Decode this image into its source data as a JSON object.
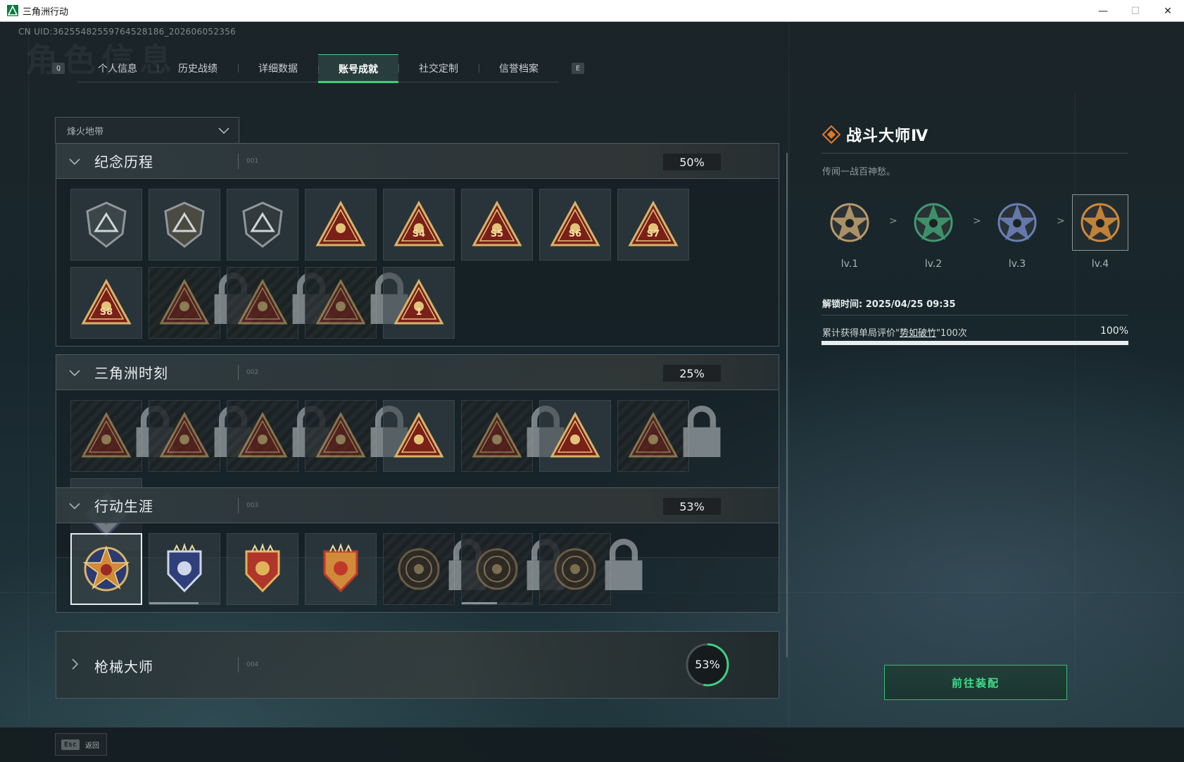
{
  "window": {
    "title": "三角洲行动",
    "minimize": "—",
    "maximize": "☐",
    "close": "✕"
  },
  "uid": "CN UID:3625548255976452818​6_202606052356",
  "watermark": "角色信息",
  "tabs": {
    "left_key": "Q",
    "right_key": "E",
    "items": [
      {
        "label": "个人信息",
        "active": false
      },
      {
        "label": "历史战绩",
        "active": false
      },
      {
        "label": "详细数据",
        "active": false
      },
      {
        "label": "账号成就",
        "active": true
      },
      {
        "label": "社交定制",
        "active": false
      },
      {
        "label": "信誉档案",
        "active": false
      }
    ]
  },
  "mode_select": {
    "value": "烽火地带"
  },
  "sections": [
    {
      "name": "纪念历程",
      "index": "001",
      "percent": "50%",
      "expanded": true,
      "badges": [
        {
          "icon": "triangle-shield-badge-icon",
          "locked": false
        },
        {
          "icon": "helicopter-badge-icon",
          "locked": false
        },
        {
          "icon": "diamond-shield-badge-icon",
          "locked": false
        },
        {
          "icon": "radar-dish-badge-icon",
          "locked": false
        },
        {
          "icon": "season-s4-badge-icon",
          "locked": false,
          "text": "S4"
        },
        {
          "icon": "season-s5-badge-icon",
          "locked": false,
          "text": "S5"
        },
        {
          "icon": "season-s6-badge-icon",
          "locked": false,
          "text": "S6"
        },
        {
          "icon": "season-s7-badge-icon",
          "locked": false,
          "text": "S7"
        },
        {
          "icon": "season-s8-badge-icon",
          "locked": false,
          "text": "S8"
        },
        {
          "icon": "tank-badge-icon",
          "locked": true
        },
        {
          "icon": "operator-portrait-badge-icon",
          "locked": true
        },
        {
          "icon": "crossed-rifles-badge-icon",
          "locked": true
        },
        {
          "icon": "number-one-badge-icon",
          "locked": false,
          "text": "1"
        }
      ]
    },
    {
      "name": "三角洲时刻",
      "index": "002",
      "percent": "25%",
      "expanded": true,
      "badges": [
        {
          "icon": "robot-badge-icon",
          "locked": true
        },
        {
          "icon": "armor-badge-icon",
          "locked": true
        },
        {
          "icon": "runner-badge-icon",
          "locked": true
        },
        {
          "icon": "gear-badge-icon",
          "locked": true
        },
        {
          "icon": "team-badge-icon",
          "locked": false
        },
        {
          "icon": "squad-badge-icon",
          "locked": true
        },
        {
          "icon": "rocket-badge-icon",
          "locked": false
        },
        {
          "icon": "dragon-badge-icon",
          "locked": true
        },
        {
          "icon": "cube-diamond-badge-icon",
          "locked": false
        }
      ]
    },
    {
      "name": "行动生涯",
      "index": "003",
      "percent": "53%",
      "expanded": true,
      "badges": [
        {
          "icon": "combat-master-star-badge-icon",
          "locked": false,
          "selected": true
        },
        {
          "icon": "blue-shield-badge-icon",
          "locked": false,
          "progress": 0.7
        },
        {
          "icon": "gold-wing-badge-icon",
          "locked": false
        },
        {
          "icon": "red-gem-badge-icon",
          "locked": false
        },
        {
          "icon": "helmet-ring-badge-icon",
          "locked": true
        },
        {
          "icon": "skull-ring-badge-icon",
          "locked": true,
          "progress": 0.5
        },
        {
          "icon": "eye-ring-badge-icon",
          "locked": true
        }
      ]
    },
    {
      "name": "枪械大师",
      "index": "004",
      "percent": "53%",
      "percent_value": 53,
      "expanded": false
    }
  ],
  "detail": {
    "title": "战斗大师Ⅳ",
    "description": "传闻一战百神愁。",
    "levels": [
      {
        "label": "lv.1",
        "color": "#b89a6a"
      },
      {
        "label": "lv.2",
        "color": "#3f9a6e"
      },
      {
        "label": "lv.3",
        "color": "#6a7fb8"
      },
      {
        "label": "lv.4",
        "color": "#d08a3a",
        "current": true
      }
    ],
    "unlock_time": "解锁时间: 2025/04/25 09:35",
    "requirement_prefix": "累计获得单局评价\"",
    "requirement_term": "势如破竹",
    "requirement_suffix": "\"100次",
    "requirement_percent": "100%",
    "requirement_progress": 1.0,
    "equip_button": "前往装配"
  },
  "footer": {
    "esc_key": "Esc",
    "back_label": "返回"
  },
  "colors": {
    "accent": "#3ecf7d",
    "gold": "#d6b46a",
    "red": "#9a2a22"
  }
}
